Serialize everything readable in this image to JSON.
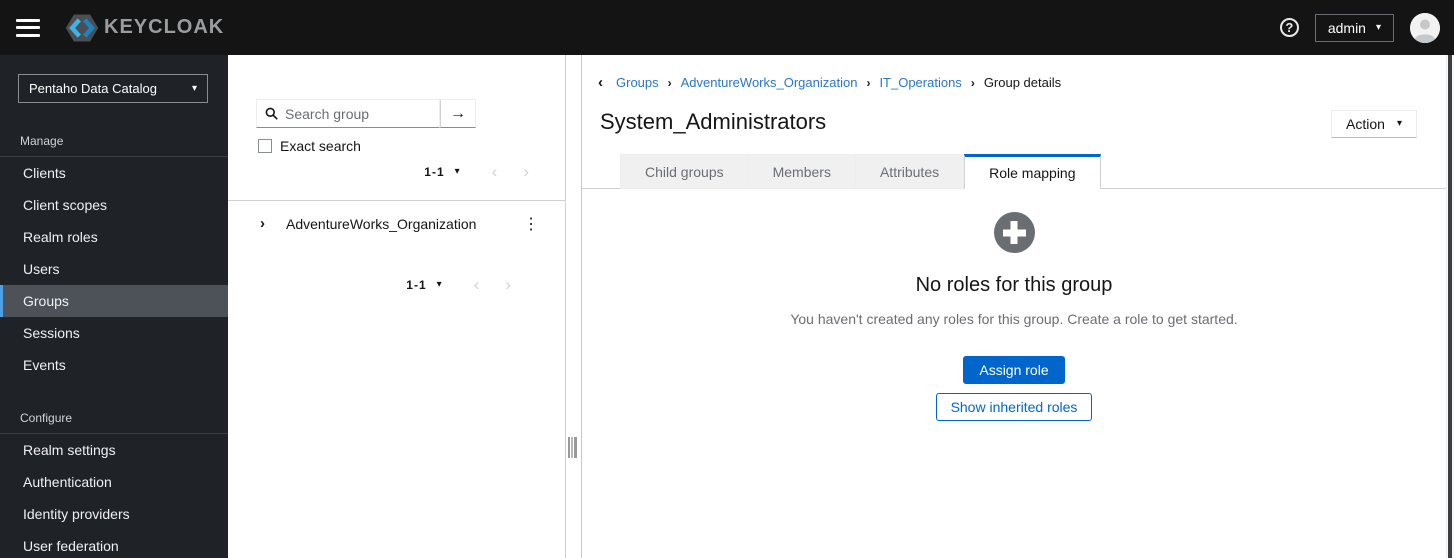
{
  "masthead": {
    "brand": "KEYCLOAK",
    "help_label": "?",
    "username": "admin"
  },
  "sidebar": {
    "realm_selector": "Pentaho Data Catalog",
    "manage_label": "Manage",
    "manage_items": [
      "Clients",
      "Client scopes",
      "Realm roles",
      "Users",
      "Groups",
      "Sessions",
      "Events"
    ],
    "configure_label": "Configure",
    "configure_items": [
      "Realm settings",
      "Authentication",
      "Identity providers",
      "User federation"
    ],
    "selected_item": "Groups"
  },
  "groups_panel": {
    "search_placeholder": "Search group",
    "search_value": "",
    "exact_search_label": "Exact search",
    "pagination_top": "1-1",
    "pagination_bottom": "1-1",
    "tree_item": "AdventureWorks_Organization"
  },
  "main": {
    "breadcrumb": {
      "links": [
        "Groups",
        "AdventureWorks_Organization",
        "IT_Operations"
      ],
      "current": "Group details"
    },
    "title": "System_Administrators",
    "action_button": "Action",
    "tabs": [
      "Child groups",
      "Members",
      "Attributes",
      "Role mapping"
    ],
    "active_tab": "Role mapping",
    "empty_state": {
      "icon": "plus-circle-icon",
      "title": "No roles for this group",
      "description": "You haven't created any roles for this group. Create a role to get started.",
      "primary_button": "Assign role",
      "secondary_button": "Show inherited roles"
    }
  },
  "colors": {
    "accent": "#0066cc",
    "masthead_bg": "#141414",
    "sidebar_bg": "#1f2327",
    "nav_active_bg": "#4d5258",
    "nav_active_border": "#4d9fe8",
    "link": "#2b77c4",
    "empty_icon": "#6a6e73"
  }
}
